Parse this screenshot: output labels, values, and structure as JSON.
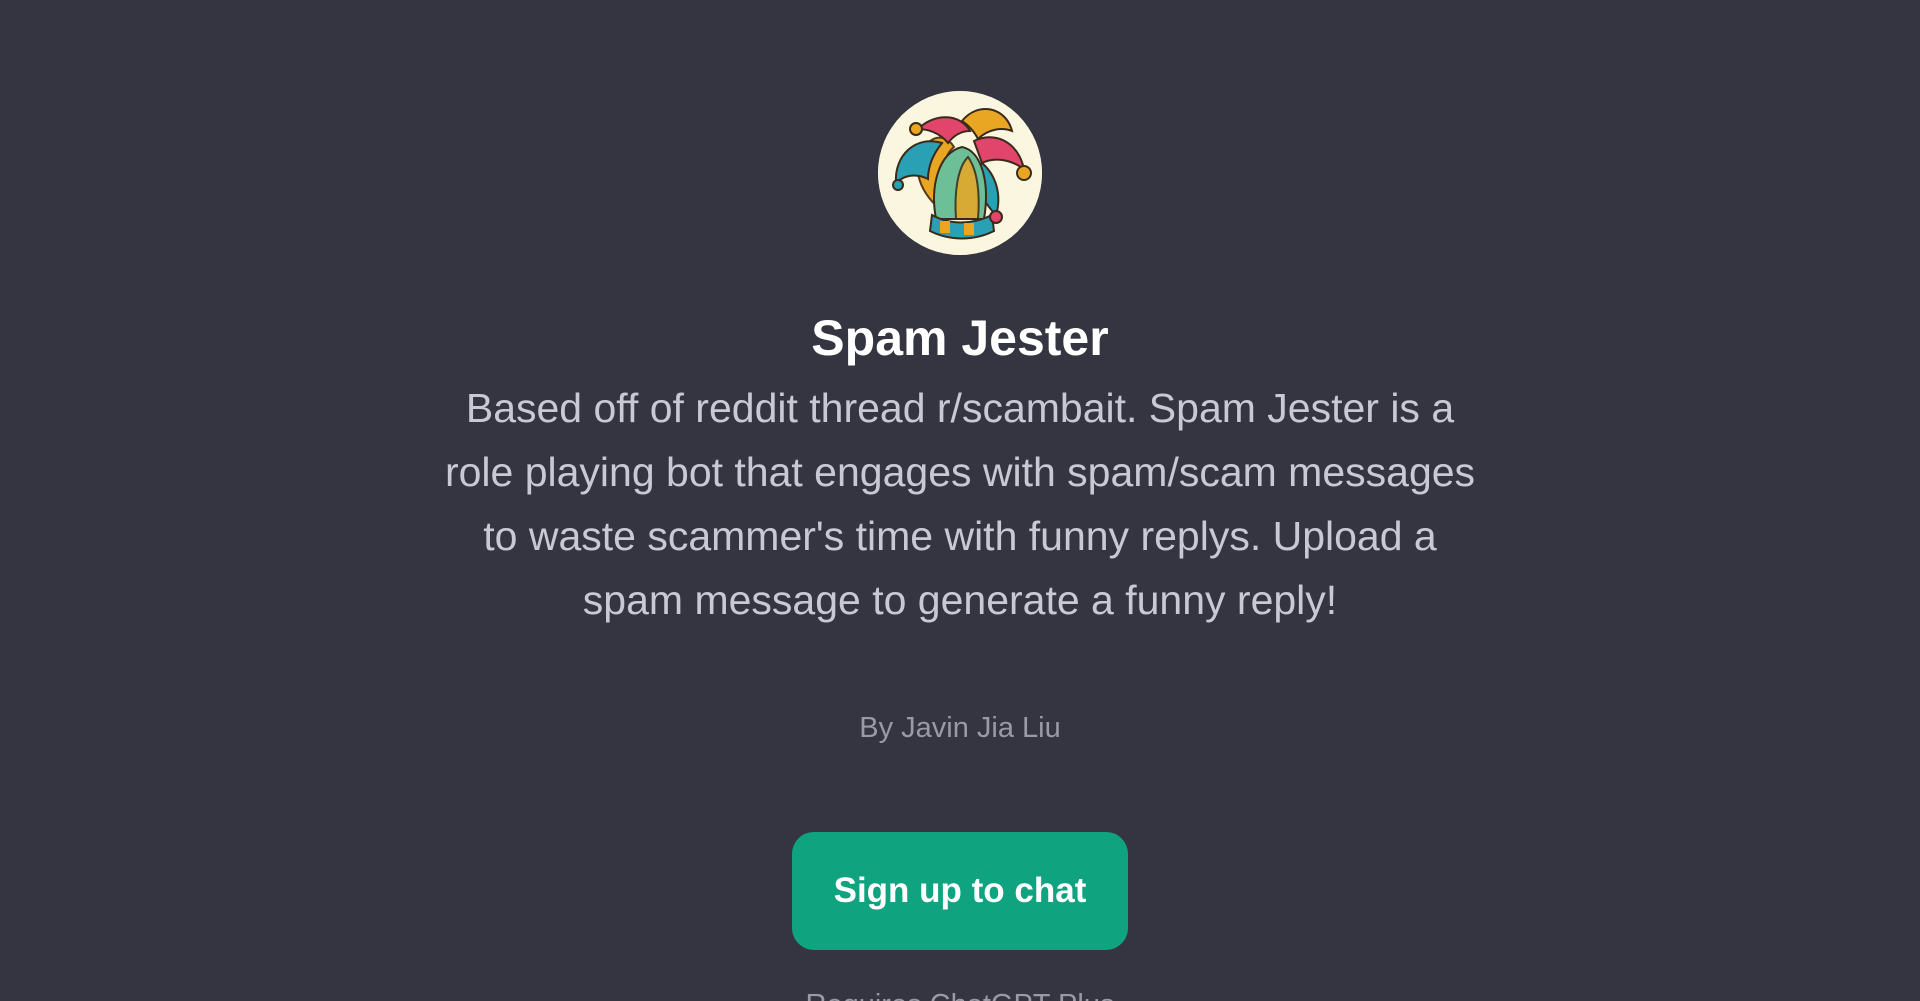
{
  "gpt": {
    "avatar_icon": "jester-hat-icon",
    "name": "Spam Jester",
    "description": "Based off of reddit thread r/scambait. Spam Jester is a role playing bot that engages with spam/scam messages to waste scammer's time with funny replys. Upload a spam message to generate a funny reply!",
    "author": "By Javin Jia Liu"
  },
  "actions": {
    "signup_label": "Sign up to chat"
  },
  "footer": {
    "text": "Requires ChatGPT Plus"
  },
  "colors": {
    "background": "#343541",
    "accent": "#10a37f",
    "title": "#ffffff",
    "description": "#c9c9d4",
    "muted": "#9a9aa6"
  }
}
